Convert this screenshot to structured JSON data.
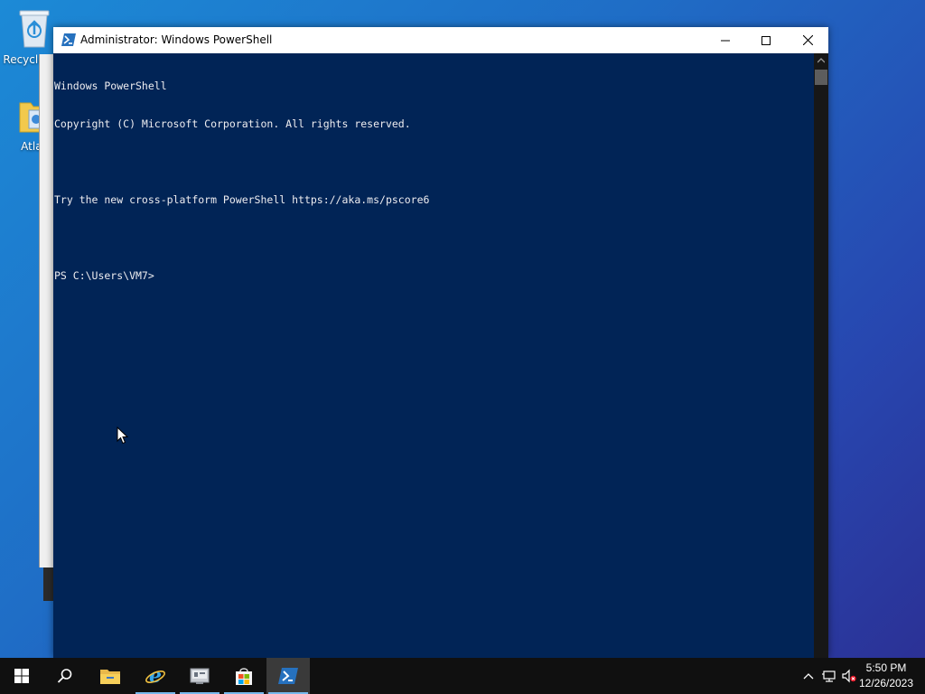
{
  "desktop": {
    "icons": [
      {
        "label": "Recycle Bin",
        "icon": "recycle-bin-icon"
      },
      {
        "label": "Atlas",
        "icon": "folder-icon"
      }
    ]
  },
  "window": {
    "title": "Administrator: Windows PowerShell",
    "icon": "powershell-icon",
    "controls": [
      "minimize-icon",
      "maximize-icon",
      "close-icon"
    ]
  },
  "console": {
    "lines": [
      "Windows PowerShell",
      "Copyright (C) Microsoft Corporation. All rights reserved.",
      "",
      "Try the new cross-platform PowerShell https://aka.ms/pscore6",
      "",
      "PS C:\\Users\\VM7>"
    ],
    "background": "#012456",
    "foreground": "#eeedf0"
  },
  "taskbar": {
    "items": [
      {
        "name": "start-icon",
        "active": false
      },
      {
        "name": "search-icon",
        "active": false
      },
      {
        "name": "file-explorer-icon",
        "active": false
      },
      {
        "name": "internet-explorer-icon",
        "active": true
      },
      {
        "name": "server-manager-icon",
        "active": true
      },
      {
        "name": "store-icon",
        "active": true
      },
      {
        "name": "powershell-icon",
        "active": true
      }
    ],
    "tray": [
      "chevron-up-icon",
      "network-icon",
      "volume-muted-icon"
    ],
    "time": "5:50 PM",
    "date": "12/26/2023",
    "accent": "#76b9ed"
  }
}
